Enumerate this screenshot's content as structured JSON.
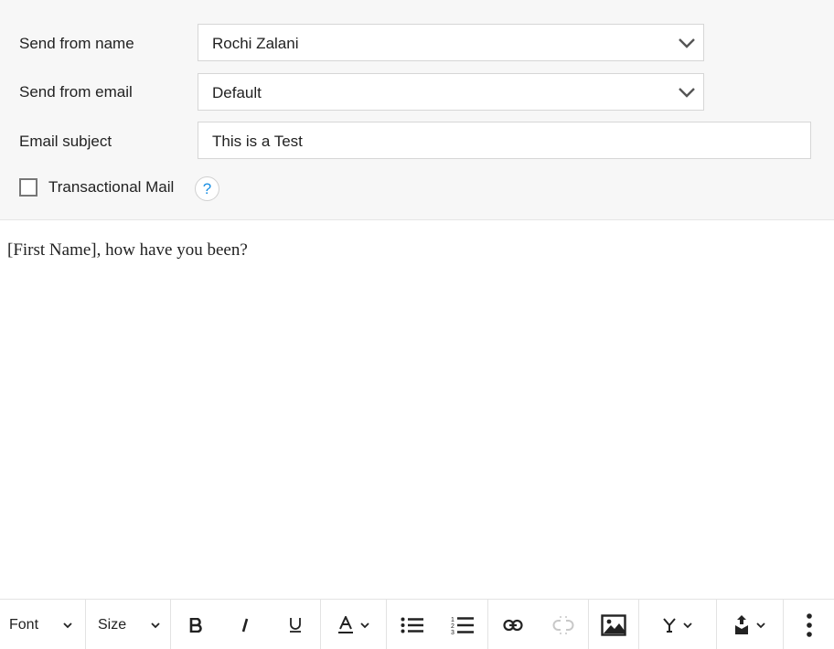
{
  "form": {
    "send_from_name": {
      "label": "Send from name",
      "value": "Rochi Zalani"
    },
    "send_from_email": {
      "label": "Send from email",
      "value": "Default"
    },
    "email_subject": {
      "label": "Email subject",
      "value": "This is a Test"
    },
    "transactional": {
      "label": "Transactional Mail",
      "checked": false,
      "help": "?"
    }
  },
  "editor": {
    "content": "[First Name], how have you been?"
  },
  "toolbar": {
    "font_label": "Font",
    "size_label": "Size",
    "icons": [
      "bold-icon",
      "italic-icon",
      "underline-icon",
      "text-color-icon",
      "bullet-list-icon",
      "numbered-list-icon",
      "link-icon",
      "unlink-icon",
      "image-icon",
      "merge-tag-icon",
      "insert-icon",
      "more-icon"
    ]
  },
  "colors": {
    "accent": "#1a8fe3",
    "header_bg": "#f7f7f7",
    "unlink_disabled": "#c8c8c8"
  }
}
